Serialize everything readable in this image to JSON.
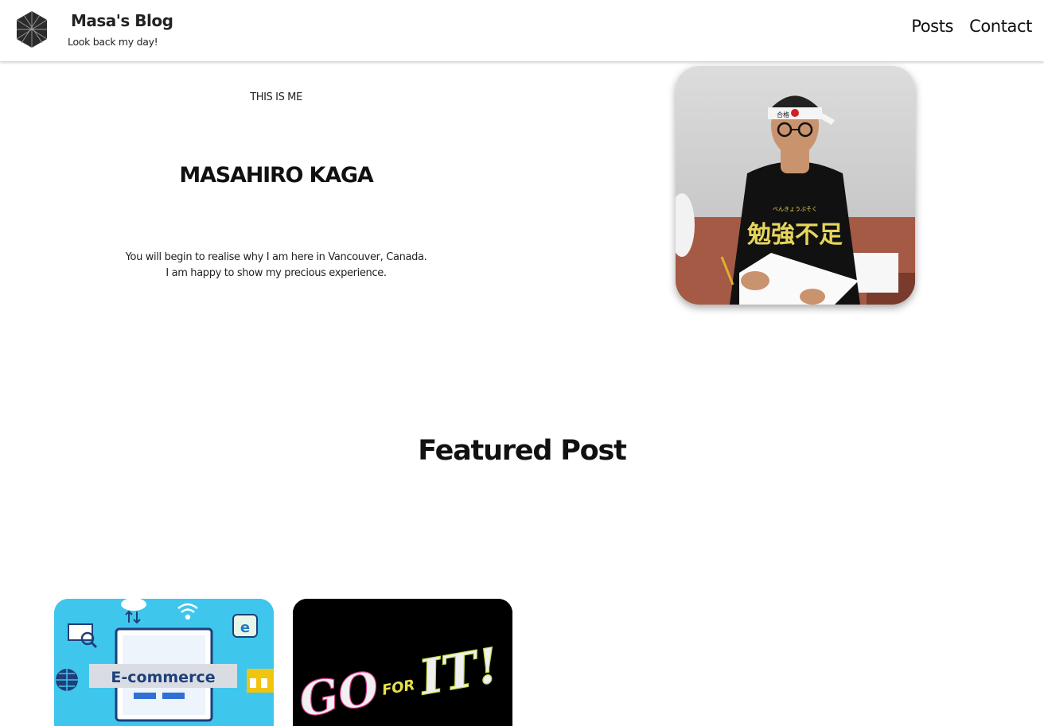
{
  "header": {
    "logo_icon": "hexagon-logo-icon",
    "title": "Masa's Blog",
    "subtitle": "Look back my day!",
    "nav": [
      {
        "label": "Posts"
      },
      {
        "label": "Contact"
      }
    ]
  },
  "hero": {
    "eyebrow": "THIS IS ME",
    "name": "MASAHIRO KAGA",
    "text_line1": "You will begin to realise why I am here in Vancouver, Canada.",
    "text_line2": "I am happy to show my precious experience.",
    "portrait_shirt_text": "勉強不足",
    "portrait_shirt_small": "べんきょうぶそく"
  },
  "featured": {
    "title": "Featured Post",
    "cards": [
      {
        "image_text": "E-commerce",
        "image_letter": "e",
        "accent_color": "#3fc6ec"
      },
      {
        "image_text_go": "GO",
        "image_text_for": "FOR",
        "image_text_it": "IT!",
        "accent_color": "#000000"
      }
    ]
  }
}
